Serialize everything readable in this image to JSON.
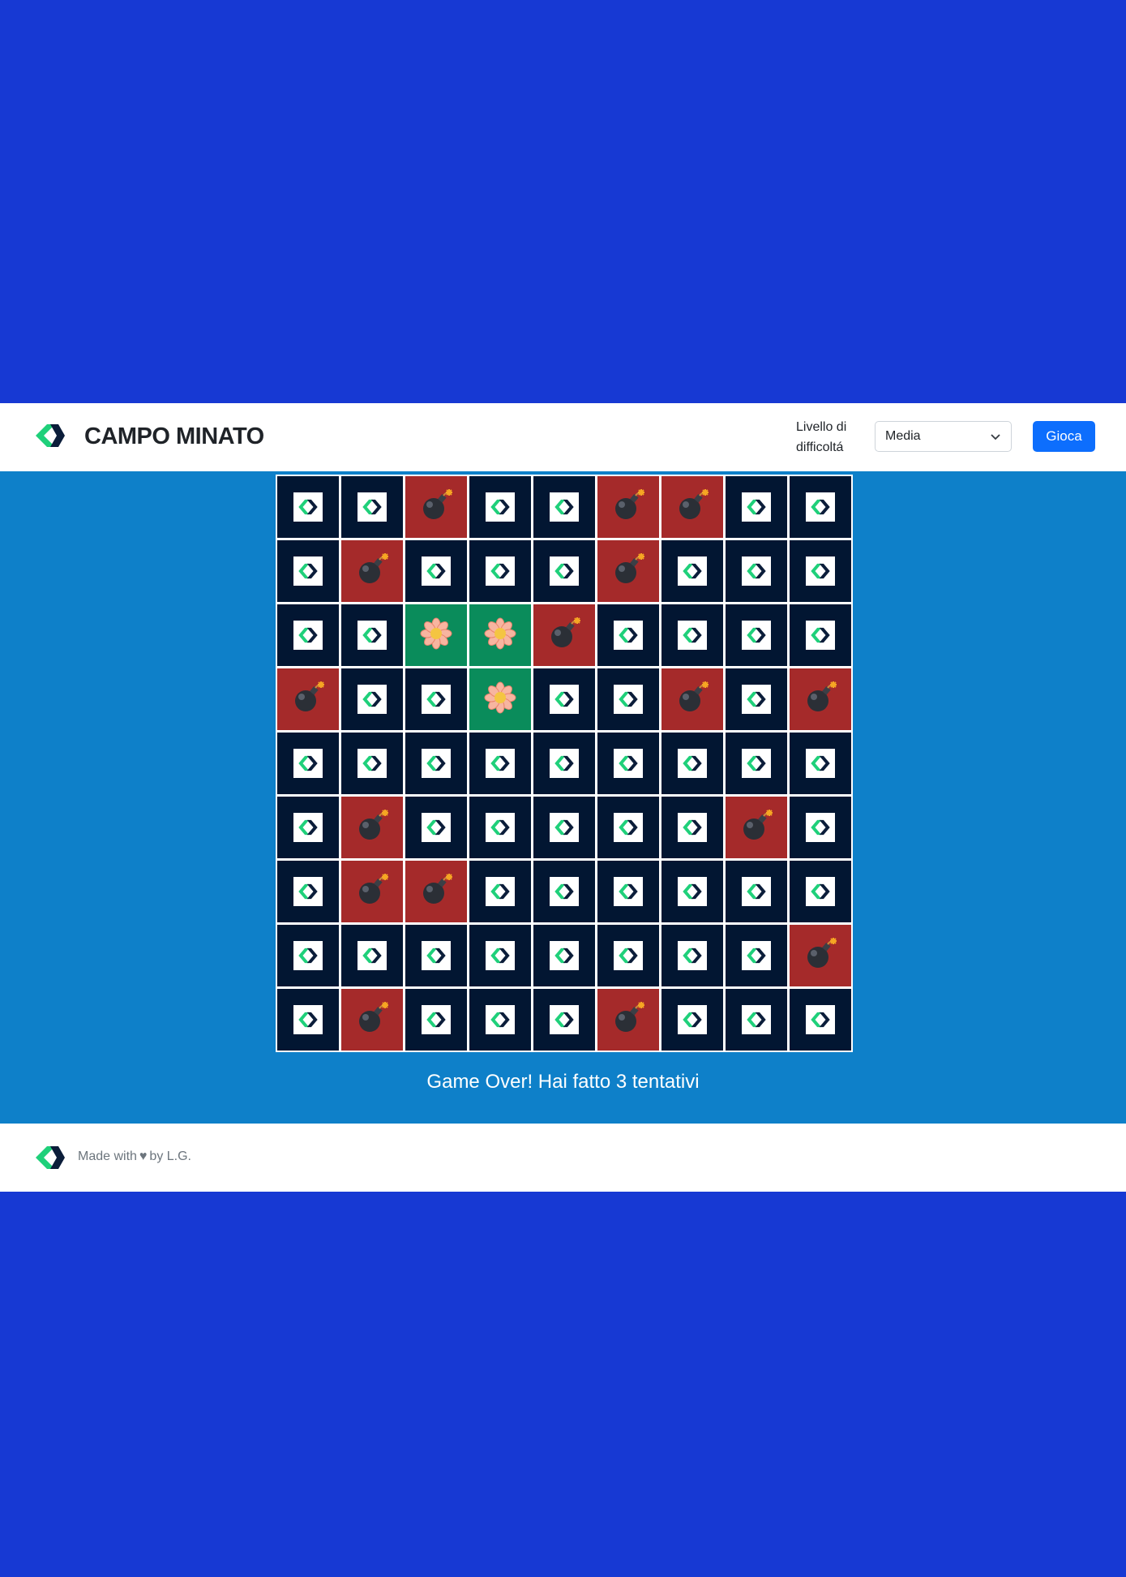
{
  "header": {
    "title": "CAMPO MINATO",
    "level_label": "Livello di difficoltá",
    "difficulty_selected": "Media",
    "play_button": "Gioca"
  },
  "board": {
    "rows": 9,
    "cols": 9,
    "cells": [
      [
        "hidden",
        "hidden",
        "bomb",
        "hidden",
        "hidden",
        "bomb",
        "bomb",
        "hidden",
        "hidden"
      ],
      [
        "hidden",
        "bomb",
        "hidden",
        "hidden",
        "hidden",
        "bomb",
        "hidden",
        "hidden",
        "hidden"
      ],
      [
        "hidden",
        "hidden",
        "flower",
        "flower",
        "bomb",
        "hidden",
        "hidden",
        "hidden",
        "hidden"
      ],
      [
        "bomb",
        "hidden",
        "hidden",
        "flower",
        "hidden",
        "hidden",
        "bomb",
        "hidden",
        "bomb"
      ],
      [
        "hidden",
        "hidden",
        "hidden",
        "hidden",
        "hidden",
        "hidden",
        "hidden",
        "hidden",
        "hidden"
      ],
      [
        "hidden",
        "bomb",
        "hidden",
        "hidden",
        "hidden",
        "hidden",
        "hidden",
        "bomb",
        "hidden"
      ],
      [
        "hidden",
        "bomb",
        "bomb",
        "hidden",
        "hidden",
        "hidden",
        "hidden",
        "hidden",
        "hidden"
      ],
      [
        "hidden",
        "hidden",
        "hidden",
        "hidden",
        "hidden",
        "hidden",
        "hidden",
        "hidden",
        "bomb"
      ],
      [
        "hidden",
        "bomb",
        "hidden",
        "hidden",
        "hidden",
        "bomb",
        "hidden",
        "hidden",
        "hidden"
      ]
    ],
    "icons": {
      "hidden": "logo-tile-icon",
      "bomb": "bomb-icon",
      "flower": "flower-icon"
    }
  },
  "status": {
    "message": "Game Over! Hai fatto 3 tentativi"
  },
  "footer": {
    "made_with": "Made with",
    "by": "by L.G."
  },
  "colors": {
    "page_bg": "#1739d3",
    "main_bg": "#0e80c9",
    "hidden_cell": "#021632",
    "bomb_cell": "#a52a2a",
    "flower_cell": "#0a8c5b",
    "button": "#0d6efd",
    "logo_green": "#1fd07a",
    "logo_dark": "#0b1d3a"
  }
}
